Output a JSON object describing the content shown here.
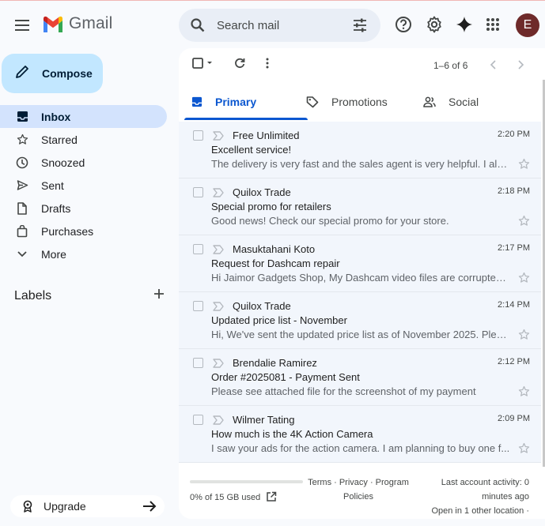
{
  "app": {
    "name": "Gmail",
    "avatar_letter": "E"
  },
  "search": {
    "placeholder": "Search mail"
  },
  "compose": {
    "label": "Compose"
  },
  "sidebar": {
    "items": [
      {
        "label": "Inbox",
        "icon": "inbox-icon",
        "active": true
      },
      {
        "label": "Starred",
        "icon": "star-icon"
      },
      {
        "label": "Snoozed",
        "icon": "clock-icon"
      },
      {
        "label": "Sent",
        "icon": "send-icon"
      },
      {
        "label": "Drafts",
        "icon": "file-icon"
      },
      {
        "label": "Purchases",
        "icon": "bag-icon"
      },
      {
        "label": "More",
        "icon": "chevron-down-icon"
      }
    ],
    "labels_title": "Labels",
    "upgrade_label": "Upgrade"
  },
  "toolbar": {
    "count": "1–6 of 6"
  },
  "tabs": [
    {
      "label": "Primary",
      "active": true
    },
    {
      "label": "Promotions"
    },
    {
      "label": "Social"
    }
  ],
  "emails": [
    {
      "sender": "Free Unlimited",
      "time": "2:20 PM",
      "subject": "Excellent service!",
      "snippet": "The delivery is very fast and the sales agent is very helpful. I also..."
    },
    {
      "sender": "Quilox Trade",
      "time": "2:18 PM",
      "subject": "Special promo for retailers",
      "snippet": "Good news! Check our special promo for your store."
    },
    {
      "sender": "Masuktahani Koto",
      "time": "2:17 PM",
      "subject": "Request for Dashcam repair",
      "snippet": "Hi Jaimor Gadgets Shop, My Dashcam video files are corrupted. ..."
    },
    {
      "sender": "Quilox Trade",
      "time": "2:14 PM",
      "subject": "Updated price list - November",
      "snippet": "Hi, We've sent the updated price list as of November 2025. Pleas..."
    },
    {
      "sender": "Brendalie Ramirez",
      "time": "2:12 PM",
      "subject": "Order #2025081 - Payment Sent",
      "snippet": "Please see attached file for the screenshot of my payment"
    },
    {
      "sender": "Wilmer Tating",
      "time": "2:09 PM",
      "subject": "How much is the 4K Action Camera",
      "snippet": "I saw your ads for the action camera. I am planning to buy one f..."
    }
  ],
  "footer": {
    "storage": "0% of 15 GB used",
    "storage_fraction": 0,
    "terms_line1": "Terms · Privacy · Program",
    "terms_line2": "Policies",
    "activity_line1": "Last account activity: 0",
    "activity_line2": "minutes ago",
    "activity_line3": "Open in 1 other location ·"
  },
  "colors": {
    "accent": "#0b57d0",
    "compose_bg": "#c2e7ff",
    "active_nav": "#d3e3fd",
    "avatar_bg": "#6e2a2a"
  }
}
